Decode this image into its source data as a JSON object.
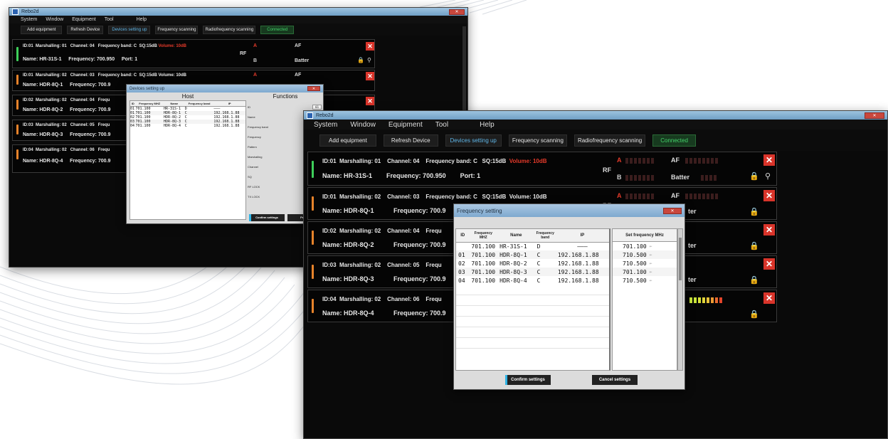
{
  "app_title": "Rebo2d",
  "menu": [
    "System",
    "Window",
    "Equipment",
    "Tool",
    "Help"
  ],
  "toolbar": [
    "Add equipment",
    "Refresh Device",
    "Devices setting up",
    "Frequency scanning",
    "Radiofrequency scanning",
    "Connected"
  ],
  "devices": [
    {
      "id": "ID:01",
      "marshalling": "Marshalling: 01",
      "channel": "Channel: 04",
      "band": "Frequency band: C",
      "sq": "SQ:15dB",
      "volume": "Volume: 10dB",
      "name": "Name: HR-31S-1",
      "frequency": "Frequency: 700.950",
      "port": "Port: 1",
      "stripe_color": "#3ecf5a",
      "volume_color": "#e53a2a"
    },
    {
      "id": "ID:01",
      "marshalling": "Marshalling: 02",
      "channel": "Channel: 03",
      "band": "Frequency band: C",
      "sq": "SQ:15dB",
      "volume": "Volume: 10dB",
      "name": "Name: HDR-8Q-1",
      "frequency": "Frequency: 700.9",
      "port": "",
      "stripe_color": "#e7832a",
      "volume_color": "#e8e8e8"
    },
    {
      "id": "ID:02",
      "marshalling": "Marshalling: 02",
      "channel": "Channel: 04",
      "band": "Frequ",
      "sq": "",
      "volume": "",
      "name": "Name: HDR-8Q-2",
      "frequency": "Frequency: 700.9",
      "port": "",
      "stripe_color": "#e7832a",
      "volume_color": "#e8e8e8"
    },
    {
      "id": "ID:03",
      "marshalling": "Marshalling: 02",
      "channel": "Channel: 05",
      "band": "Frequ",
      "sq": "",
      "volume": "",
      "name": "Name: HDR-8Q-3",
      "frequency": "Frequency: 700.9",
      "port": "",
      "stripe_color": "#e7832a",
      "volume_color": "#e8e8e8"
    },
    {
      "id": "ID:04",
      "marshalling": "Marshalling: 02",
      "channel": "Channel: 06",
      "band": "Frequ",
      "sq": "",
      "volume": "",
      "name": "Name: HDR-8Q-4",
      "frequency": "Frequency: 700.9",
      "port": "",
      "stripe_color": "#e7832a",
      "volume_color": "#e8e8e8"
    }
  ],
  "meters": {
    "a": "A",
    "b": "B",
    "rf": "RF",
    "af": "AF",
    "batter": "Batter",
    "rf_cut": "RF",
    "af_cut": "ter"
  },
  "freq_dialog": {
    "title": "Frequency setting",
    "columns": [
      "ID",
      "Frequency MHZ",
      "Name",
      "Frequency band",
      "IP",
      "Set frequency MHz"
    ],
    "rows": [
      {
        "id": "",
        "freq": "701.100",
        "name": "HR-31S-1",
        "band": "D",
        "ip": "———",
        "set": "701.100"
      },
      {
        "id": "01",
        "freq": "701.100",
        "name": "HDR-8Q-1",
        "band": "C",
        "ip": "192.168.1.88",
        "set": "710.500"
      },
      {
        "id": "02",
        "freq": "701.100",
        "name": "HDR-8Q-2",
        "band": "C",
        "ip": "192.168.1.88",
        "set": "710.500"
      },
      {
        "id": "03",
        "freq": "701.100",
        "name": "HDR-8Q-3",
        "band": "C",
        "ip": "192.168.1.88",
        "set": "701.100"
      },
      {
        "id": "04",
        "freq": "701.100",
        "name": "HDR-8Q-4",
        "band": "C",
        "ip": "192.168.1.88",
        "set": "710.500"
      }
    ],
    "stepper_arrow": "⇐",
    "confirm": "Confirm settings",
    "cancel": "Cancel settings"
  },
  "bg_dialog": {
    "title": "Devices setting up",
    "host_header": "Host",
    "functions_header": "Functions",
    "columns": [
      "ID",
      "Frequency MHZ",
      "Name",
      "Frequency band",
      "IP"
    ],
    "rows": [
      {
        "id": "01",
        "freq": "701.100",
        "name": "HR-31S-1",
        "band": "D",
        "ip": "———"
      },
      {
        "id": "01",
        "freq": "701.100",
        "name": "HDR-8Q-1",
        "band": "C",
        "ip": "192.168.1.88"
      },
      {
        "id": "02",
        "freq": "701.100",
        "name": "HDR-8Q-2",
        "band": "C",
        "ip": "192.168.1.88"
      },
      {
        "id": "03",
        "freq": "701.100",
        "name": "HDR-8Q-3",
        "band": "C",
        "ip": "192.168.1.88"
      },
      {
        "id": "04",
        "freq": "701.100",
        "name": "HDR-8Q-4",
        "band": "C",
        "ip": "192.168.1.88"
      }
    ],
    "functions": [
      {
        "label": "ID",
        "value": "01"
      },
      {
        "label": "Name",
        "value": "HR-31S"
      },
      {
        "label": "Frequency band",
        "value": "D"
      },
      {
        "label": "Frequency",
        "value": "701.100"
      },
      {
        "label": "Pattern",
        "value": "GROUP"
      },
      {
        "label": "Marshalling",
        "value": "01"
      },
      {
        "label": "Channel",
        "value": "04"
      },
      {
        "label": "SQ",
        "value": "05"
      },
      {
        "label": "RF LOCK",
        "value": "ON"
      },
      {
        "label": "TX LOCK",
        "value": "TX"
      }
    ],
    "confirm": "Confirm settings",
    "pair": "Pair fre"
  }
}
